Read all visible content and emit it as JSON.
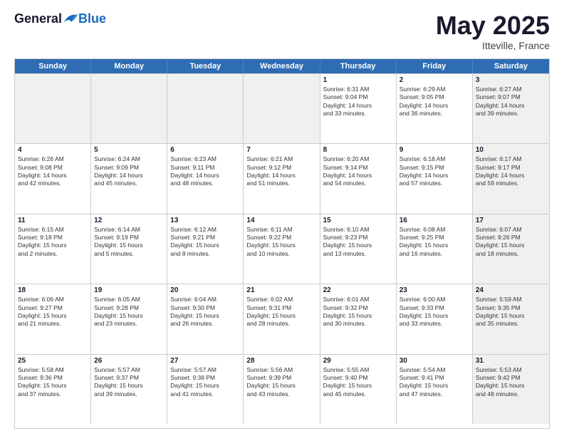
{
  "logo": {
    "general": "General",
    "blue": "Blue"
  },
  "title": "May 2025",
  "location": "Itteville, France",
  "days_of_week": [
    "Sunday",
    "Monday",
    "Tuesday",
    "Wednesday",
    "Thursday",
    "Friday",
    "Saturday"
  ],
  "weeks": [
    [
      {
        "day": "",
        "info": [],
        "shaded": true
      },
      {
        "day": "",
        "info": [],
        "shaded": true
      },
      {
        "day": "",
        "info": [],
        "shaded": true
      },
      {
        "day": "",
        "info": [],
        "shaded": true
      },
      {
        "day": "1",
        "info": [
          "Sunrise: 6:31 AM",
          "Sunset: 9:04 PM",
          "Daylight: 14 hours",
          "and 33 minutes."
        ],
        "shaded": false
      },
      {
        "day": "2",
        "info": [
          "Sunrise: 6:29 AM",
          "Sunset: 9:05 PM",
          "Daylight: 14 hours",
          "and 36 minutes."
        ],
        "shaded": false
      },
      {
        "day": "3",
        "info": [
          "Sunrise: 6:27 AM",
          "Sunset: 9:07 PM",
          "Daylight: 14 hours",
          "and 39 minutes."
        ],
        "shaded": true
      }
    ],
    [
      {
        "day": "4",
        "info": [
          "Sunrise: 6:26 AM",
          "Sunset: 9:08 PM",
          "Daylight: 14 hours",
          "and 42 minutes."
        ],
        "shaded": false
      },
      {
        "day": "5",
        "info": [
          "Sunrise: 6:24 AM",
          "Sunset: 9:09 PM",
          "Daylight: 14 hours",
          "and 45 minutes."
        ],
        "shaded": false
      },
      {
        "day": "6",
        "info": [
          "Sunrise: 6:23 AM",
          "Sunset: 9:11 PM",
          "Daylight: 14 hours",
          "and 48 minutes."
        ],
        "shaded": false
      },
      {
        "day": "7",
        "info": [
          "Sunrise: 6:21 AM",
          "Sunset: 9:12 PM",
          "Daylight: 14 hours",
          "and 51 minutes."
        ],
        "shaded": false
      },
      {
        "day": "8",
        "info": [
          "Sunrise: 6:20 AM",
          "Sunset: 9:14 PM",
          "Daylight: 14 hours",
          "and 54 minutes."
        ],
        "shaded": false
      },
      {
        "day": "9",
        "info": [
          "Sunrise: 6:18 AM",
          "Sunset: 9:15 PM",
          "Daylight: 14 hours",
          "and 57 minutes."
        ],
        "shaded": false
      },
      {
        "day": "10",
        "info": [
          "Sunrise: 6:17 AM",
          "Sunset: 9:17 PM",
          "Daylight: 14 hours",
          "and 59 minutes."
        ],
        "shaded": true
      }
    ],
    [
      {
        "day": "11",
        "info": [
          "Sunrise: 6:15 AM",
          "Sunset: 9:18 PM",
          "Daylight: 15 hours",
          "and 2 minutes."
        ],
        "shaded": false
      },
      {
        "day": "12",
        "info": [
          "Sunrise: 6:14 AM",
          "Sunset: 9:19 PM",
          "Daylight: 15 hours",
          "and 5 minutes."
        ],
        "shaded": false
      },
      {
        "day": "13",
        "info": [
          "Sunrise: 6:12 AM",
          "Sunset: 9:21 PM",
          "Daylight: 15 hours",
          "and 8 minutes."
        ],
        "shaded": false
      },
      {
        "day": "14",
        "info": [
          "Sunrise: 6:11 AM",
          "Sunset: 9:22 PM",
          "Daylight: 15 hours",
          "and 10 minutes."
        ],
        "shaded": false
      },
      {
        "day": "15",
        "info": [
          "Sunrise: 6:10 AM",
          "Sunset: 9:23 PM",
          "Daylight: 15 hours",
          "and 13 minutes."
        ],
        "shaded": false
      },
      {
        "day": "16",
        "info": [
          "Sunrise: 6:08 AM",
          "Sunset: 9:25 PM",
          "Daylight: 15 hours",
          "and 16 minutes."
        ],
        "shaded": false
      },
      {
        "day": "17",
        "info": [
          "Sunrise: 6:07 AM",
          "Sunset: 9:26 PM",
          "Daylight: 15 hours",
          "and 18 minutes."
        ],
        "shaded": true
      }
    ],
    [
      {
        "day": "18",
        "info": [
          "Sunrise: 6:06 AM",
          "Sunset: 9:27 PM",
          "Daylight: 15 hours",
          "and 21 minutes."
        ],
        "shaded": false
      },
      {
        "day": "19",
        "info": [
          "Sunrise: 6:05 AM",
          "Sunset: 9:28 PM",
          "Daylight: 15 hours",
          "and 23 minutes."
        ],
        "shaded": false
      },
      {
        "day": "20",
        "info": [
          "Sunrise: 6:04 AM",
          "Sunset: 9:30 PM",
          "Daylight: 15 hours",
          "and 26 minutes."
        ],
        "shaded": false
      },
      {
        "day": "21",
        "info": [
          "Sunrise: 6:02 AM",
          "Sunset: 9:31 PM",
          "Daylight: 15 hours",
          "and 28 minutes."
        ],
        "shaded": false
      },
      {
        "day": "22",
        "info": [
          "Sunrise: 6:01 AM",
          "Sunset: 9:32 PM",
          "Daylight: 15 hours",
          "and 30 minutes."
        ],
        "shaded": false
      },
      {
        "day": "23",
        "info": [
          "Sunrise: 6:00 AM",
          "Sunset: 9:33 PM",
          "Daylight: 15 hours",
          "and 33 minutes."
        ],
        "shaded": false
      },
      {
        "day": "24",
        "info": [
          "Sunrise: 5:59 AM",
          "Sunset: 9:35 PM",
          "Daylight: 15 hours",
          "and 35 minutes."
        ],
        "shaded": true
      }
    ],
    [
      {
        "day": "25",
        "info": [
          "Sunrise: 5:58 AM",
          "Sunset: 9:36 PM",
          "Daylight: 15 hours",
          "and 37 minutes."
        ],
        "shaded": false
      },
      {
        "day": "26",
        "info": [
          "Sunrise: 5:57 AM",
          "Sunset: 9:37 PM",
          "Daylight: 15 hours",
          "and 39 minutes."
        ],
        "shaded": false
      },
      {
        "day": "27",
        "info": [
          "Sunrise: 5:57 AM",
          "Sunset: 9:38 PM",
          "Daylight: 15 hours",
          "and 41 minutes."
        ],
        "shaded": false
      },
      {
        "day": "28",
        "info": [
          "Sunrise: 5:56 AM",
          "Sunset: 9:39 PM",
          "Daylight: 15 hours",
          "and 43 minutes."
        ],
        "shaded": false
      },
      {
        "day": "29",
        "info": [
          "Sunrise: 5:55 AM",
          "Sunset: 9:40 PM",
          "Daylight: 15 hours",
          "and 45 minutes."
        ],
        "shaded": false
      },
      {
        "day": "30",
        "info": [
          "Sunrise: 5:54 AM",
          "Sunset: 9:41 PM",
          "Daylight: 15 hours",
          "and 47 minutes."
        ],
        "shaded": false
      },
      {
        "day": "31",
        "info": [
          "Sunrise: 5:53 AM",
          "Sunset: 9:42 PM",
          "Daylight: 15 hours",
          "and 48 minutes."
        ],
        "shaded": true
      }
    ]
  ]
}
